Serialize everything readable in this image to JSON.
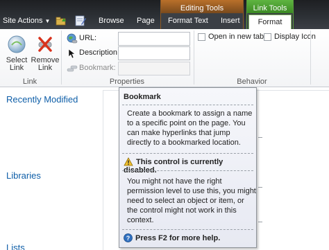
{
  "top_nav": {
    "site_actions": "Site Actions",
    "tabs": [
      "Browse",
      "Page"
    ],
    "editing_tools": {
      "title": "Editing Tools",
      "tabs": [
        "Format Text",
        "Insert"
      ]
    },
    "link_tools": {
      "title": "Link Tools",
      "active_tab": "Format"
    }
  },
  "ribbon": {
    "link_group": {
      "label": "Link",
      "select_link": "Select\nLink",
      "remove_link": "Remove\nLink"
    },
    "properties_group": {
      "label": "Properties",
      "url_label": "URL:",
      "url_value": "",
      "description_label": "Description:",
      "description_value": "",
      "bookmark_label": "Bookmark:",
      "bookmark_value": ""
    },
    "behavior_group": {
      "label": "Behavior",
      "open_new_tab": "Open in new tab",
      "display_icon": "Display Icon"
    }
  },
  "left_nav": {
    "recently_modified": "Recently Modified",
    "libraries": "Libraries",
    "lists": "Lists"
  },
  "tooltip": {
    "title": "Bookmark",
    "description": "Create a bookmark to assign a name to a specific point on the page.  You can make hyperlinks that jump directly to a bookmarked location.",
    "warning": "This control is currently disabled.",
    "permission_text": "You might not have the right permission level to use this, you might need to select an object or item, or the control might not work in this context.",
    "help": "Press F2 for more help."
  },
  "colors": {
    "top_bar": "#2e3237",
    "editing_tools": "#b9702a",
    "link_tools": "#5fb441",
    "link_text": "#0e5ea8"
  }
}
